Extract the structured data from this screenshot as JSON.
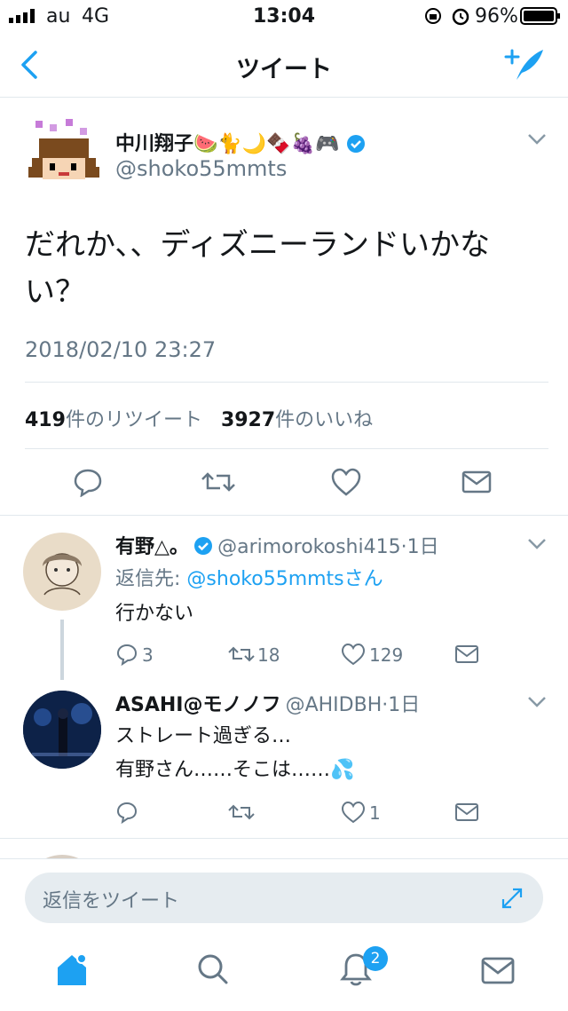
{
  "status_bar": {
    "carrier": "au",
    "network": "4G",
    "time": "13:04",
    "battery": "96%"
  },
  "nav": {
    "title": "ツイート"
  },
  "main_tweet": {
    "author_name": "中川翔子🍉🐈🌙🍫🍇🎮",
    "handle": "@shoko55mmts",
    "text": "だれか、、ディズニーランドいかない？",
    "date": "2018/02/10 23:27",
    "retweet_count": "419",
    "retweet_label": "件のリツイート",
    "like_count": "3927",
    "like_label": "件のいいね"
  },
  "replies": [
    {
      "author_name": "有野△。",
      "handle": "@arimorokoshi415",
      "time": "·1日",
      "reply_to_label": "返信先:",
      "reply_to_handle": "@shoko55mmtsさん",
      "lines": [
        "行かない"
      ],
      "replies": "3",
      "retweets": "18",
      "likes": "129"
    },
    {
      "author_name": "ASAHI@モノノフ",
      "handle": "@AHIDBH",
      "time": "·1日",
      "lines": [
        "ストレート過ぎる…",
        "有野さん……そこは……💦"
      ],
      "replies": "",
      "retweets": "",
      "likes": "1"
    }
  ],
  "composer": {
    "placeholder": "返信をツイート"
  },
  "tabbar": {
    "notifications_badge": "2"
  },
  "colors": {
    "accent": "#1da1f2",
    "secondary_text": "#657786",
    "divider": "#e1e8ed"
  }
}
